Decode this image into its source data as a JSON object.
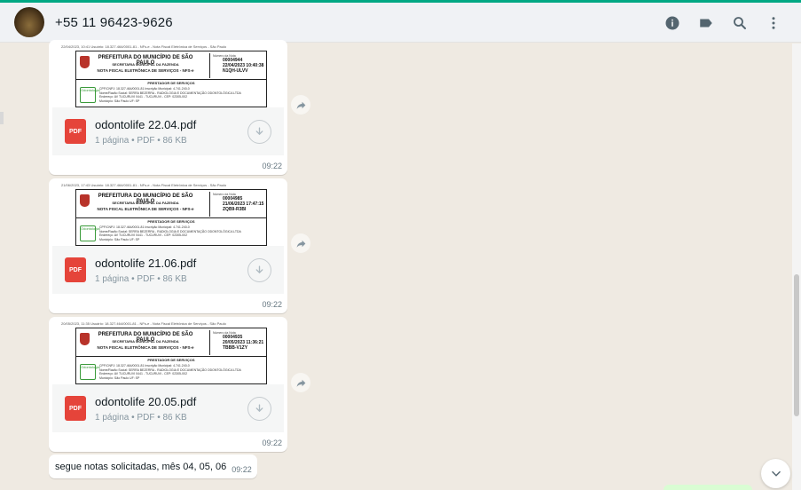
{
  "header": {
    "contact_name": "+55 11 96423-9626",
    "icons": [
      "info-icon",
      "label-icon",
      "search-icon",
      "menu-icon"
    ]
  },
  "theme": {
    "accent": "#00a884",
    "pdf_red": "#e5443a",
    "bubble_bg": "#ffffff",
    "chat_bg": "#efeae2"
  },
  "messages": [
    {
      "type": "document",
      "file_name": "odontolife 22.04.pdf",
      "meta": "1 página • PDF • 86 KB",
      "time": "09:22",
      "icon_label": "PDF",
      "preview": {
        "top_line": "22/04/2023, 10:41     Usuário: 18.327.464/0001-81 - NFs-e - Nota Fiscal Eletrônica de Serviços - São Paulo",
        "title": "PREFEITURA DO MUNICÍPIO DE SÃO PAULO",
        "subtitle": "SECRETARIA MUNICIPAL DA FAZENDA",
        "nfs": "NOTA FISCAL ELETRÔNICA DE SERVIÇOS - NFS-e",
        "number_label": "Número da Nota",
        "number": "00004944",
        "date": "22/04/2023 10:40:38",
        "code": "N1QH-ULVV",
        "section": "PRESTADOR DE SERVIÇOS",
        "rows": [
          "CPF/CNPJ: 18.327.464/0001-81   Inscrição Municipal: 4.741.240-0",
          "Nome/Razão Social: SERRA BEZERRA - RADIOLOGIA E DOCUMENTAÇÃO ODONTOLÓGICA LTDA",
          "Endereço: AV TUCURUVI 0441 - TUCURUVI - CEP: 02305-002",
          "Município: São Paulo   UF: SP"
        ],
        "logo_text": "Odontologia"
      }
    },
    {
      "type": "document",
      "file_name": "odontolife 21.06.pdf",
      "meta": "1 página • PDF • 86 KB",
      "time": "09:22",
      "icon_label": "PDF",
      "preview": {
        "top_line": "21/06/2023, 17:43     Usuário: 18.327.464/0001-81 - NFs-e - Nota Fiscal Eletrônica de Serviços - São Paulo",
        "title": "PREFEITURA DO MUNICÍPIO DE SÃO PAULO",
        "subtitle": "SECRETARIA MUNICIPAL DA FAZENDA",
        "nfs": "NOTA FISCAL ELETRÔNICA DE SERVIÇOS - NFS-e",
        "number_label": "Número da Nota",
        "number": "00004985",
        "date": "21/06/2023 17:47:15",
        "code": "ZQB9-R3BI",
        "section": "PRESTADOR DE SERVIÇOS",
        "rows": [
          "CPF/CNPJ: 18.327.464/0001-81   Inscrição Municipal: 4.741.240-0",
          "Nome/Razão Social: SERRA BEZERRA - RADIOLOGIA E DOCUMENTAÇÃO ODONTOLÓGICA LTDA",
          "Endereço: AV TUCURUVI 0441 - TUCURUVI - CEP: 02305-002",
          "Município: São Paulo   UF: SP"
        ],
        "logo_text": "Odontologia"
      }
    },
    {
      "type": "document",
      "file_name": "odontolife 20.05.pdf",
      "meta": "1 página • PDF • 86 KB",
      "time": "09:22",
      "icon_label": "PDF",
      "preview": {
        "top_line": "20/05/2023, 11:35     Usuário: 18.327.464/0001-81 - NFs-e - Nota Fiscal Eletrônica de Serviços - São Paulo",
        "title": "PREFEITURA DO MUNICÍPIO DE SÃO PAULO",
        "subtitle": "SECRETARIA MUNICIPAL DA FAZENDA",
        "nfs": "NOTA FISCAL ELETRÔNICA DE SERVIÇOS - NFS-e",
        "number_label": "Número da Nota",
        "number": "00004935",
        "date": "20/05/2023 11:36:21",
        "code": "TBBB-V1ZY",
        "section": "PRESTADOR DE SERVIÇOS",
        "rows": [
          "CPF/CNPJ: 18.327.464/0001-81   Inscrição Municipal: 4.741.240-0",
          "Nome/Razão Social: SERRA BEZERRA - RADIOLOGIA E DOCUMENTAÇÃO ODONTOLÓGICA LTDA",
          "Endereço: AV TUCURUVI 0441 - TUCURUVI - CEP: 02305-002",
          "Município: São Paulo   UF: SP"
        ],
        "logo_text": "Odontologia"
      }
    }
  ],
  "text_message": {
    "text": "segue notas solicitadas, mês 04, 05, 06",
    "time": "09:22"
  }
}
